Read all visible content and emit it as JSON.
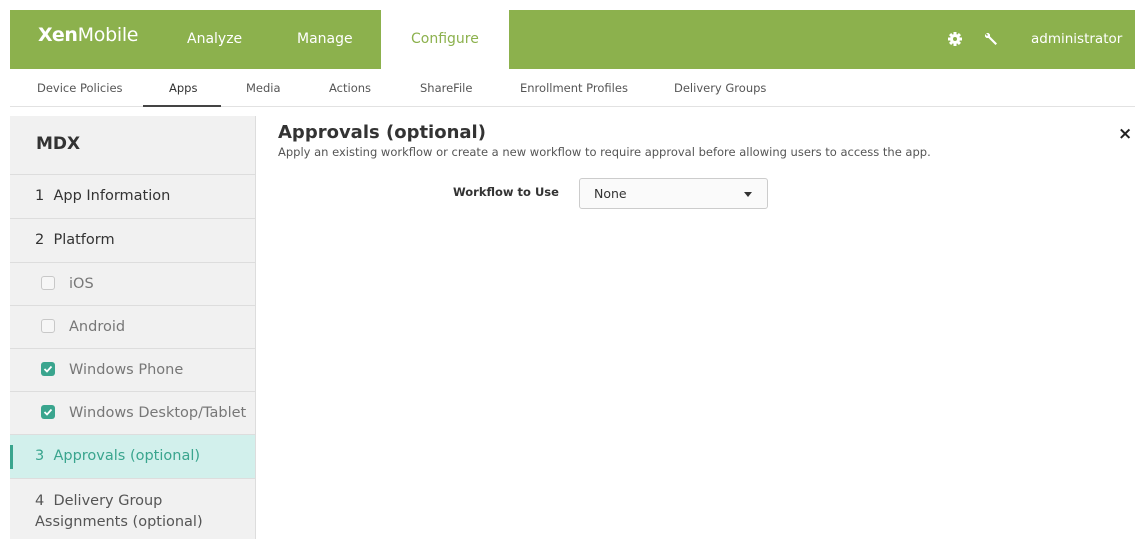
{
  "header": {
    "brand_bold": "Xen",
    "brand_light": "Mobile",
    "tabs": [
      {
        "label": "Analyze"
      },
      {
        "label": "Manage"
      },
      {
        "label": "Configure",
        "active": true
      }
    ],
    "user": "administrator",
    "accent_color": "#8cb14d"
  },
  "subnav": {
    "tabs": [
      {
        "label": "Device Policies"
      },
      {
        "label": "Apps",
        "active": true
      },
      {
        "label": "Media"
      },
      {
        "label": "Actions"
      },
      {
        "label": "ShareFile"
      },
      {
        "label": "Enrollment Profiles"
      },
      {
        "label": "Delivery Groups"
      }
    ]
  },
  "sidebar": {
    "title": "MDX",
    "items": [
      {
        "label": "1  App Information"
      },
      {
        "label": "2  Platform"
      },
      {
        "label": "iOS",
        "checked": false
      },
      {
        "label": "Android",
        "checked": false
      },
      {
        "label": "Windows Phone",
        "checked": true
      },
      {
        "label": "Windows Desktop/Tablet",
        "checked": true
      },
      {
        "label": "3  Approvals (optional)",
        "active": true
      },
      {
        "label": "4  Delivery Group Assignments (optional)"
      }
    ],
    "active_color": "#3aa58e"
  },
  "main": {
    "title": "Approvals (optional)",
    "description": "Apply an existing workflow or create a new workflow to require approval before allowing users to access the app.",
    "close": "×",
    "workflow": {
      "label": "Workflow to Use",
      "value": "None"
    }
  }
}
